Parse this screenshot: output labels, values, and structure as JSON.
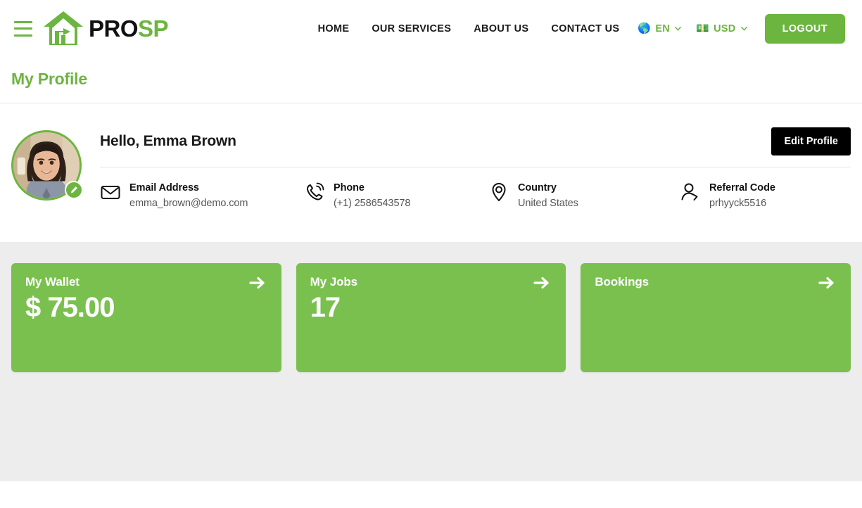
{
  "header": {
    "menu_icon": "hamburger-icon",
    "logo": {
      "icon": "house-tool-logo-icon",
      "text_primary": "PRO",
      "text_accent": "SP"
    },
    "nav_links": [
      {
        "label": "HOME"
      },
      {
        "label": "OUR SERVICES"
      },
      {
        "label": "ABOUT US"
      },
      {
        "label": "CONTACT US"
      }
    ],
    "language_selector": {
      "icon": "globe-icon",
      "label": "EN",
      "chevron": "chevron-down-icon"
    },
    "currency_selector": {
      "icon": "money-icon",
      "label": "USD",
      "chevron": "chevron-down-icon"
    },
    "logout_label": "LOGOUT"
  },
  "page": {
    "title": "My Profile"
  },
  "profile": {
    "avatar": {
      "name": "user-avatar",
      "edit_icon": "pencil-icon"
    },
    "greeting": "Hello, Emma Brown",
    "edit_profile_label": "Edit Profile",
    "details": [
      {
        "icon": "envelope-icon",
        "label": "Email Address",
        "value": "emma_brown@demo.com"
      },
      {
        "icon": "phone-icon",
        "label": "Phone",
        "value": "(+1) 2586543578"
      },
      {
        "icon": "location-pin-icon",
        "label": "Country",
        "value": "United States"
      },
      {
        "icon": "referral-user-icon",
        "label": "Referral Code",
        "value": "prhyyck5516"
      }
    ]
  },
  "stats": [
    {
      "label": "My Wallet",
      "value": "$ 75.00",
      "arrow": "arrow-right-icon"
    },
    {
      "label": "My Jobs",
      "value": "17",
      "arrow": "arrow-right-icon"
    },
    {
      "label": "Bookings",
      "value": "",
      "arrow": "arrow-right-icon"
    }
  ],
  "colors": {
    "brand_green": "#6cb53f",
    "card_green": "#7ac04f",
    "content_bg": "#ededed",
    "button_black": "#000000"
  }
}
